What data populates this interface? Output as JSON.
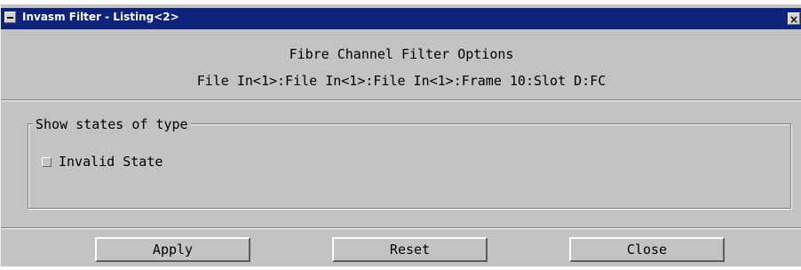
{
  "window": {
    "title": "Invasm Filter - Listing<2>",
    "close_glyph": "×",
    "titlebar_color": "#0f237d",
    "background_color": "#c3c3c3"
  },
  "header": {
    "line1": "Fibre Channel Filter Options",
    "line2": "File In<1>:File In<1>:File In<1>:Frame 10:Slot D:FC"
  },
  "group": {
    "label": "Show states of type",
    "options": [
      {
        "label": "Invalid State",
        "checked": false
      }
    ]
  },
  "buttons": {
    "apply": "Apply",
    "reset": "Reset",
    "close": "Close"
  }
}
